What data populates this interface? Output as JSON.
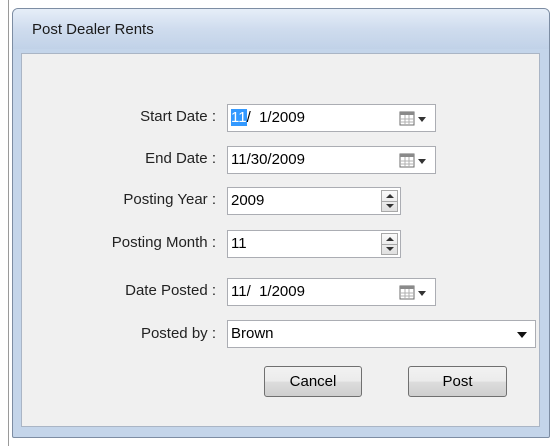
{
  "window": {
    "title": "Post Dealer Rents"
  },
  "form": {
    "start_date": {
      "label": "Start Date :",
      "value_selected": "11",
      "value_rest": "/  1/2009"
    },
    "end_date": {
      "label": "End Date :",
      "value": "11/30/2009"
    },
    "posting_year": {
      "label": "Posting Year :",
      "value": "2009"
    },
    "posting_month": {
      "label": "Posting Month :",
      "value": "11"
    },
    "date_posted": {
      "label": "Date Posted :",
      "value": "11/  1/2009"
    },
    "posted_by": {
      "label": "Posted by :",
      "value": "Brown"
    }
  },
  "buttons": {
    "cancel": "Cancel",
    "post": "Post"
  },
  "icons": {
    "calendar": "calendar-dropdown-icon",
    "spinner": "up-down-spinner-icon",
    "dropdown": "chevron-down-icon"
  }
}
